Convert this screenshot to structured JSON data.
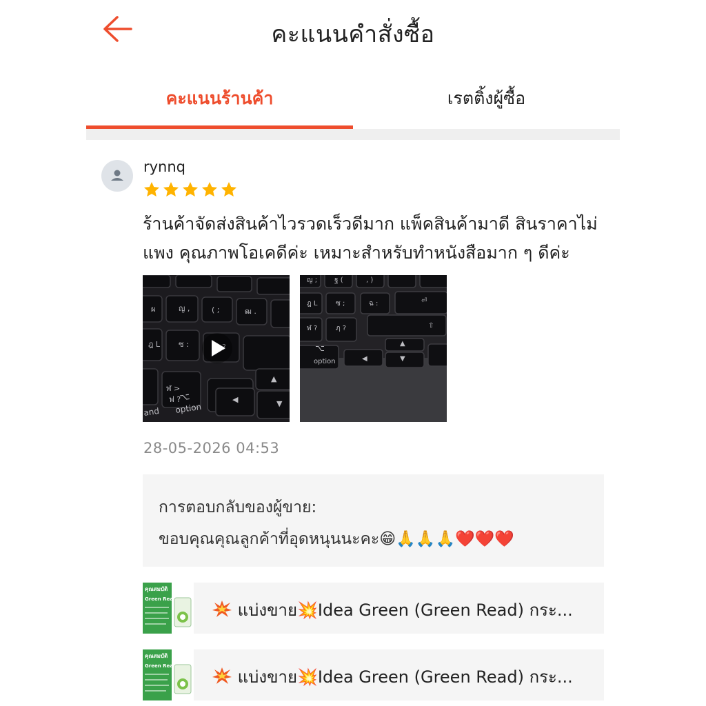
{
  "header": {
    "title": "คะแนนคำสั่งซื้อ",
    "back_icon": "arrow-left-icon",
    "accent": "#ee4d2d"
  },
  "tabs": [
    {
      "label": "คะแนนร้านค้า",
      "active": true
    },
    {
      "label": "เรตติ้งผู้ซื้อ",
      "active": false
    }
  ],
  "review": {
    "username": "rynnq",
    "rating": 5,
    "text": "ร้านค้าจัดส่งสินค้าไวรวดเร็วดีมาก แพ็คสินค้ามาดี สินราคาไม่แพง คุณภาพโอเคดีค่ะ เหมาะสำหรับทำหนังสือมาก ๆ ดีค่ะ",
    "media": [
      {
        "type": "video",
        "icon": "play-icon",
        "key_label": "option",
        "key_label_2": "and"
      },
      {
        "type": "image",
        "key_label": "option"
      }
    ],
    "timestamp": "28-05-2026 04:53"
  },
  "seller_reply": {
    "label": "การตอบกลับของผู้ขาย:",
    "text": "ขอบคุณคุณลูกค้าที่อุดหนุนนะคะ😁🙏🙏🙏❤️❤️❤️"
  },
  "products": [
    {
      "name": "แบ่งขาย💥Idea Green (Green Read) กระ...",
      "thumb_text": "คุณสมบัติ",
      "thumb_subtext": "Green Read"
    },
    {
      "name": "แบ่งขาย💥Idea Green (Green Read) กระ...",
      "thumb_text": "คุณสมบัติ",
      "thumb_subtext": "Green Read"
    }
  ]
}
